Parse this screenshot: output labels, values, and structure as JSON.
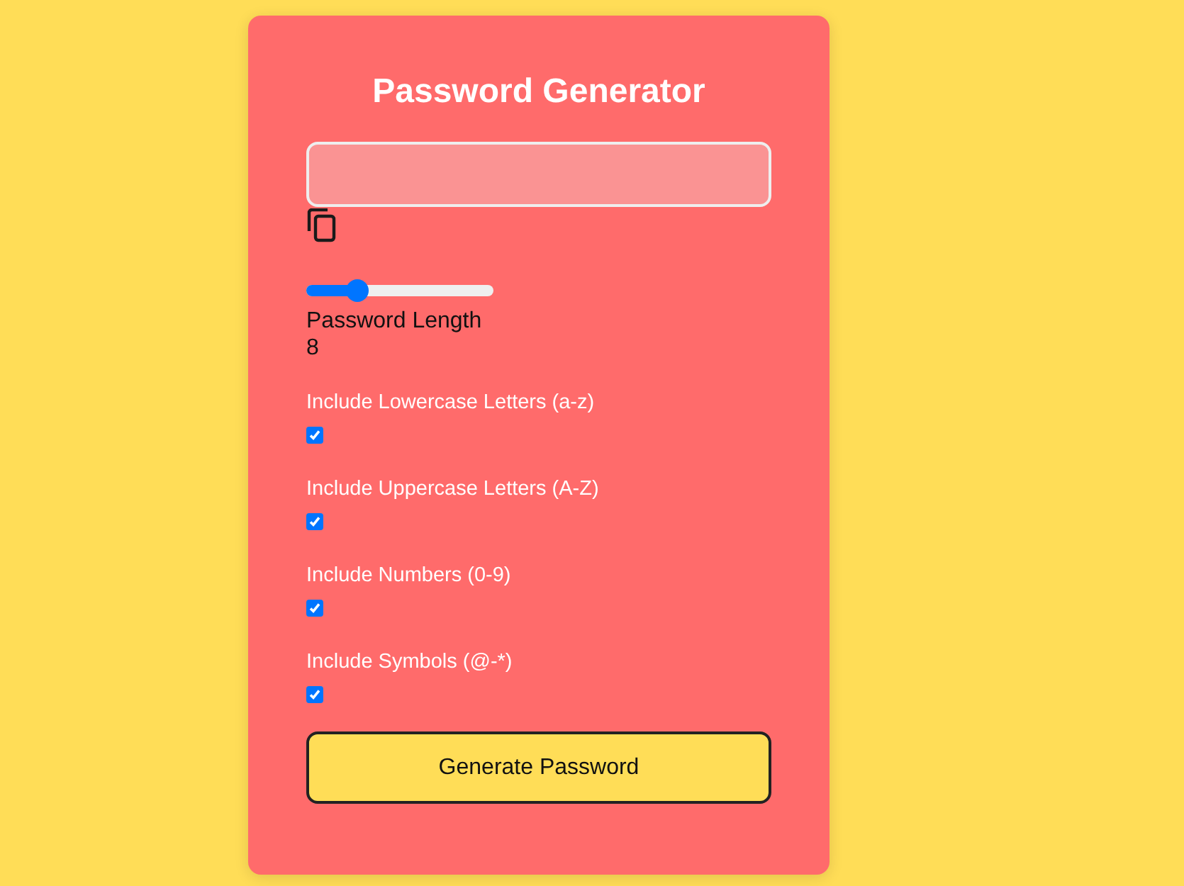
{
  "title": "Password Generator",
  "length": {
    "level": 0.27,
    "label": "Password Length",
    "value": "8"
  },
  "options": [
    {
      "label": "Include Lowercase Letters (a-z)",
      "checked": true
    },
    {
      "label": "Include Uppercase Letters (A-Z)",
      "checked": true
    },
    {
      "label": "Include Numbers (0-9)",
      "checked": true
    },
    {
      "label": "Include Symbols (@-*)",
      "checked": true
    }
  ],
  "button": "Generate Password"
}
